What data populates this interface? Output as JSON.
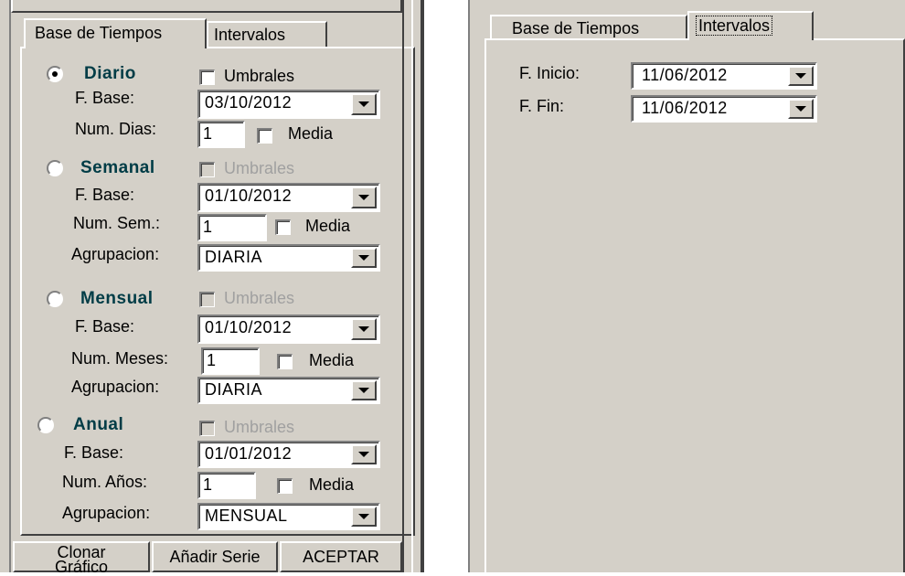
{
  "left": {
    "tabs": [
      {
        "label": "Base de Tiempos",
        "active": true
      },
      {
        "label": "Intervalos",
        "active": false
      }
    ],
    "diario": {
      "title": "Diario",
      "selected": true,
      "umbrales_label": "Umbrales",
      "fbase_label": "F. Base:",
      "fbase_value": "03/10/2012",
      "num_label": "Num. Dias:",
      "num_value": "1",
      "media_label": "Media"
    },
    "semanal": {
      "title": "Semanal",
      "selected": false,
      "umbrales_label": "Umbrales",
      "fbase_label": "F. Base:",
      "fbase_value": "01/10/2012",
      "num_label": "Num. Sem.:",
      "num_value": "1",
      "media_label": "Media",
      "agrup_label": "Agrupacion:",
      "agrup_value": "DIARIA"
    },
    "mensual": {
      "title": "Mensual",
      "selected": false,
      "umbrales_label": "Umbrales",
      "fbase_label": "F. Base:",
      "fbase_value": "01/10/2012",
      "num_label": "Num. Meses:",
      "num_value": "1",
      "media_label": "Media",
      "agrup_label": "Agrupacion:",
      "agrup_value": "DIARIA"
    },
    "anual": {
      "title": "Anual",
      "selected": false,
      "umbrales_label": "Umbrales",
      "fbase_label": "F. Base:",
      "fbase_value": "01/01/2012",
      "num_label": "Num. Años:",
      "num_value": "1",
      "media_label": "Media",
      "agrup_label": "Agrupacion:",
      "agrup_value": "MENSUAL"
    },
    "buttons": {
      "clonar_line1": "Clonar",
      "clonar_line2": "Gráfico",
      "anadir": "Añadir Serie",
      "aceptar": "ACEPTAR"
    }
  },
  "right": {
    "tabs": [
      {
        "label": "Base de Tiempos",
        "active": false
      },
      {
        "label": "Intervalos",
        "active": true
      }
    ],
    "inicio_label": "F. Inicio:",
    "inicio_value": "11/06/2012",
    "fin_label": "F. Fin:",
    "fin_value": "11/06/2012"
  },
  "colors": {
    "face": "#d4d0c8",
    "radio_title": "#003c46",
    "disabled": "#a0a0a0"
  }
}
